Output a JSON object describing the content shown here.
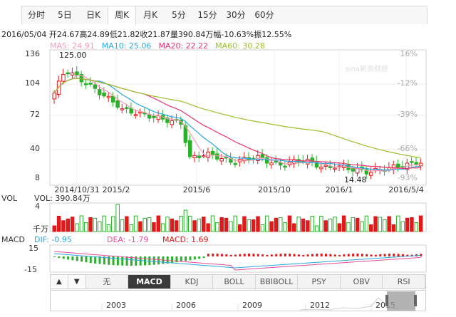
{
  "tabs": [
    "分时",
    "5日",
    "日K",
    "周K",
    "月K",
    "5分",
    "15分",
    "30分",
    "60分"
  ],
  "active_tab": "周K",
  "info_line": "2016/05/04 开24.67高24.89低21.82收21.87量390.84万幅-10.63%振12.55%",
  "ma": [
    {
      "label": "MA5: 24.91",
      "color": "#f49ab4"
    },
    {
      "label": "MA10: 25.06",
      "color": "#2aa7e0"
    },
    {
      "label": "MA20: 22.22",
      "color": "#e8336b"
    },
    {
      "label": "MA60: 30.28",
      "color": "#9bbf2a"
    }
  ],
  "price_axis": {
    "labels": [
      "136",
      "104",
      "72",
      "40",
      "8"
    ]
  },
  "pct_axis": {
    "labels": [
      "16%",
      "-12%",
      "-39%",
      "-66%",
      "-93%"
    ]
  },
  "annotations": {
    "high": "125.00",
    "low": "14.48"
  },
  "watermark": "sina新浪财经",
  "date_axis": [
    "2014/10/31",
    "2015/2",
    "2015/6",
    "2015/10",
    "2016/1",
    "2016/5/4"
  ],
  "vol": {
    "label": "VOL",
    "value": "VOL: 390.84万",
    "top_tick": "4",
    "unit": "千万"
  },
  "macd": {
    "label": "MACD",
    "dif": "DIF: -0.95",
    "dea": "DEA: -1.79",
    "macd": "MACD: 1.69",
    "ticks": [
      "15",
      "-15"
    ]
  },
  "colors": {
    "up": "#e0191b",
    "down": "#2cb02c",
    "dif": "#2aa7e0",
    "dea": "#e84c9a"
  },
  "indicator_buttons": [
    "无",
    "MACD",
    "KDJ",
    "BOLL",
    "BBIBOLL",
    "PSY",
    "OBV",
    "RSI"
  ],
  "active_indicator": "MACD",
  "nav_years": [
    "2003",
    "2006",
    "2009",
    "2012",
    "2015"
  ],
  "arrows": {
    "left": "▲",
    "right": "▼"
  }
}
